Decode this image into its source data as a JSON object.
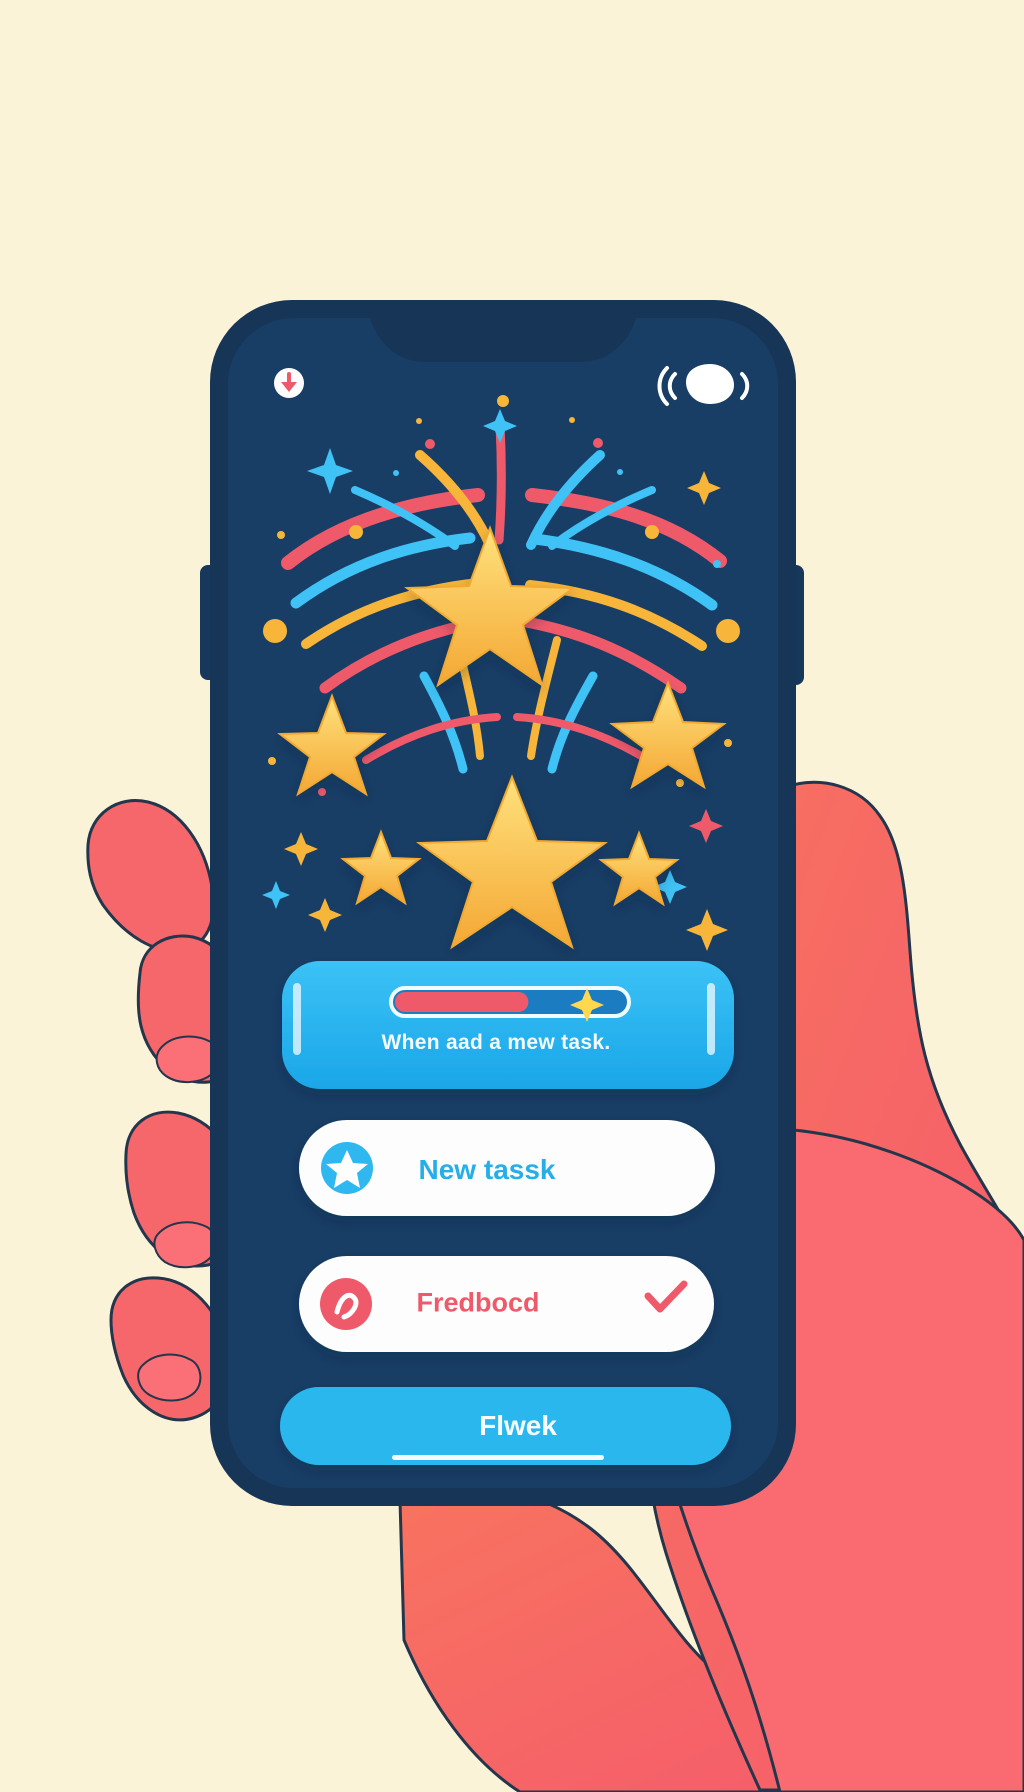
{
  "colors": {
    "background": "#fbf3d8",
    "phone_frame": "#17375b",
    "screen": "#183e66",
    "accent_blue": "#27b4ee",
    "accent_red": "#ef5a6b",
    "accent_gold": "#f7b63a",
    "card_white": "#fdfdfd",
    "hand": "#f46c72",
    "hand_shadow": "#f37f72"
  },
  "phone": {
    "status_left_icon": "notification-icon",
    "status_right_icon": "audio-icon"
  },
  "celebration": {
    "primary_icon": "fireworks-icon",
    "accent_icon": "star-icon"
  },
  "progress_card": {
    "progress_fraction": 0.58,
    "message": "When aad a mew task."
  },
  "new_task": {
    "label": "New  tassk",
    "icon": "star-icon"
  },
  "feedback": {
    "label": "Fredbocd",
    "icon": "note-icon",
    "trailing_icon": "check-icon"
  },
  "bottom_button": {
    "label": "Flwek"
  }
}
